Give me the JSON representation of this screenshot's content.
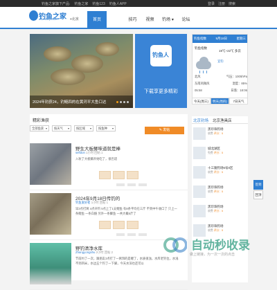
{
  "topbar": {
    "links": [
      "钓鱼之家旗下产品:",
      "钓鱼之家",
      "钓鱼123",
      "钓鱼人APP"
    ],
    "right": [
      "登录",
      "注册",
      "搜索"
    ]
  },
  "header": {
    "logo_text": "钓鱼之家",
    "logo_sub": "www.diaoyu.com",
    "location": "北京",
    "nav": [
      "首页",
      "",
      "技巧",
      "视频",
      "钓场",
      "论坛"
    ]
  },
  "slider": {
    "caption": "2024年钓获24，钓鲢四的在黄河平大鱼口达"
  },
  "ad": {
    "icon_text": "钓鱼人",
    "text": "下载享更多精彩"
  },
  "weather": {
    "title": "钓鱼指数",
    "date": "9月18日",
    "weekday": "星期三",
    "label": "钓鱼指数",
    "temp": "19℃~22℃ 多云",
    "side": "宜钓",
    "rows": [
      {
        "k": "北风",
        "v": "气压：1005hPa"
      },
      {
        "k": "东南风微风",
        "v": "湿度：85%"
      },
      {
        "k": "05:58",
        "v": "日落：18:06"
      }
    ],
    "tabs": [
      "今天(周三)",
      "明天(周四)",
      "7日天气"
    ]
  },
  "section": {
    "title": "精彩渔获",
    "filters": [
      "全部鱼获",
      "按天气",
      "按区域",
      "按鱼种"
    ],
    "post_button": "发帖"
  },
  "posts": [
    {
      "title": "野生大板鲫味道就是棒",
      "user": "selfdon",
      "time": "1小时",
      "replies": "回帖 1",
      "body": "入秋了大板鲫开始吃了，很巴适"
    },
    {
      "title": "2024年9月18日传钓的",
      "user": "钓鱼爱好者",
      "time": "1小时",
      "replies": "回帖 1",
      "body": "早3点打窝 4点开钓 5点上了1支鲤鱼 有8条平均在三斤 不到中午收口了 只上一条鲤鱼 一条白鲢 另外一条鲫鱼 一共大概5斤了"
    },
    {
      "title": "野钓清净水库",
      "user": "Zhangyongshu",
      "time": "2小时",
      "replies": "回帖 2",
      "body": "节前约了一次，跟朋友3点打了一窝饵的是鲤了，水质很浊，水库老钓位，水浅不到四米，水边五个钓了一下脚，今天水深也还可以"
    }
  ],
  "city": {
    "tabs": [
      "北京钓场",
      "北京渔具店"
    ],
    "items": [
      {
        "n": "黑珍珠钓场",
        "s": "收费",
        "score": "评分：5"
      },
      {
        "n": "城北湖区",
        "s": "免费",
        "score": "评分：5"
      },
      {
        "n": "十三陵钓场6号0区",
        "s": "收费",
        "score": "评分：5"
      },
      {
        "n": "黑珍珠钓场",
        "s": "收费",
        "score": "评分：5"
      },
      {
        "n": "黑珍珠钓场",
        "s": "收费",
        "score": "评分：5"
      },
      {
        "n": "黑珍珠钓场",
        "s": "收费",
        "score": "评分：5"
      }
    ]
  },
  "side": {
    "tab1": "签到",
    "tab2": "回顶"
  },
  "watermark": {
    "text": "自动秒收录",
    "sub": "做上链接，为一次一次的点击"
  },
  "colors": {
    "brand": "#2f7fd2",
    "accent": "#f08b27"
  }
}
